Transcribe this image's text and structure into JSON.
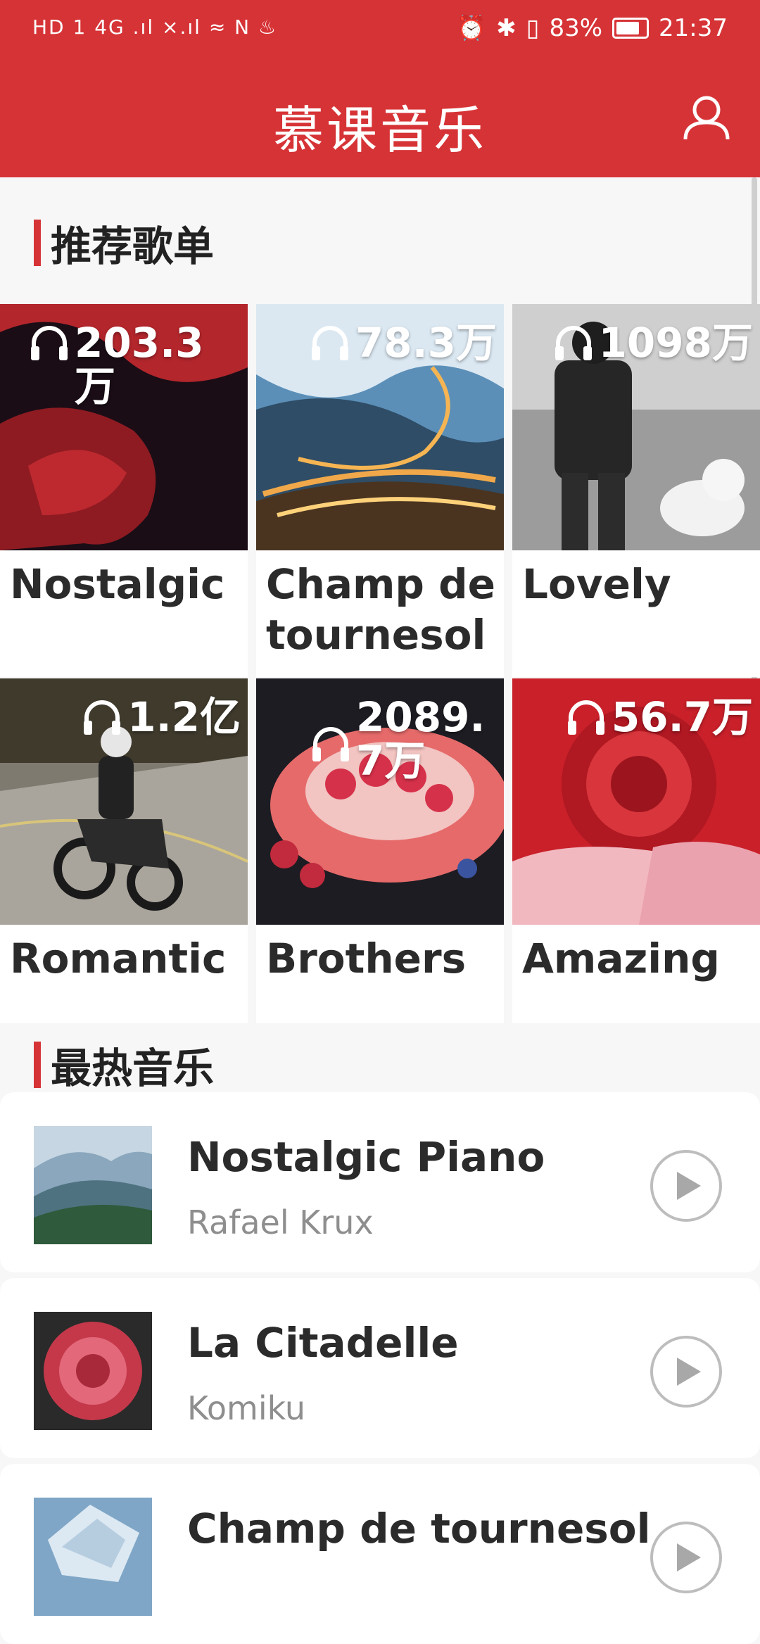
{
  "status_bar": {
    "left_icons": "HD 1 4G .ıl ×.ıl ≈ N ♨",
    "battery_percent": "83%",
    "time": "21:37"
  },
  "app_bar": {
    "title": "慕课音乐",
    "user_icon": "user-icon"
  },
  "sections": {
    "recommended_title": "推荐歌单",
    "hot_title": "最热音乐"
  },
  "playlists": [
    {
      "name": "Nostalgic",
      "plays": "203.3万"
    },
    {
      "name": "Champ de tournesol",
      "plays": "78.3万"
    },
    {
      "name": "Lovely",
      "plays": "1098万"
    },
    {
      "name": "Romantic",
      "plays": "1.2亿"
    },
    {
      "name": "Brothers",
      "plays": "2089.7万"
    },
    {
      "name": "Amazing",
      "plays": "56.7万"
    }
  ],
  "songs": [
    {
      "title": "Nostalgic Piano",
      "artist": "Rafael Krux"
    },
    {
      "title": "La Citadelle",
      "artist": "Komiku"
    },
    {
      "title": "Champ de tournesol",
      "artist": ""
    }
  ],
  "colors": {
    "brand_red": "#d63336"
  }
}
